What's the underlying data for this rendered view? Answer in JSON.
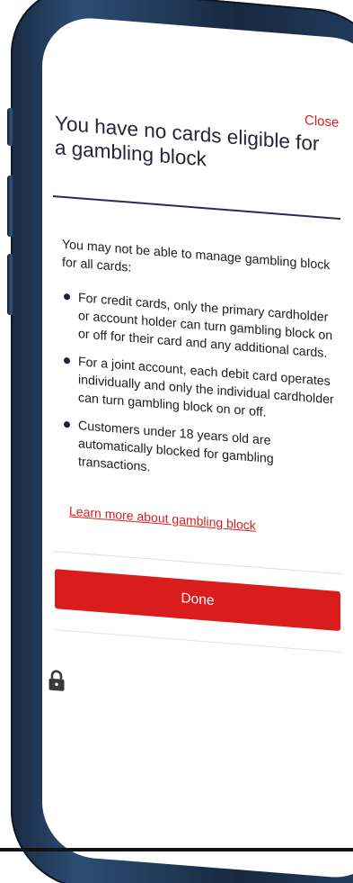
{
  "modal": {
    "close_label": "Close",
    "title": "You have no cards eligible for a gambling block",
    "intro": "You may not be able to manage gambling block for all cards:",
    "bullets": [
      "For credit cards, only the primary cardholder or account holder can turn gambling block on or off for their card and any additional cards.",
      "For a joint account, each debit card operates individually and only the individual cardholder can turn gambling block on or off.",
      "Customers under 18 years old are automatically blocked for gambling transactions."
    ],
    "learn_more_link": "Learn more about gambling block",
    "done_label": "Done"
  },
  "footer": {
    "icon": "lock-icon"
  },
  "colors": {
    "accent_red": "#db1c1c",
    "title_navy": "#25243f",
    "phone_frame": "#1f3656"
  }
}
